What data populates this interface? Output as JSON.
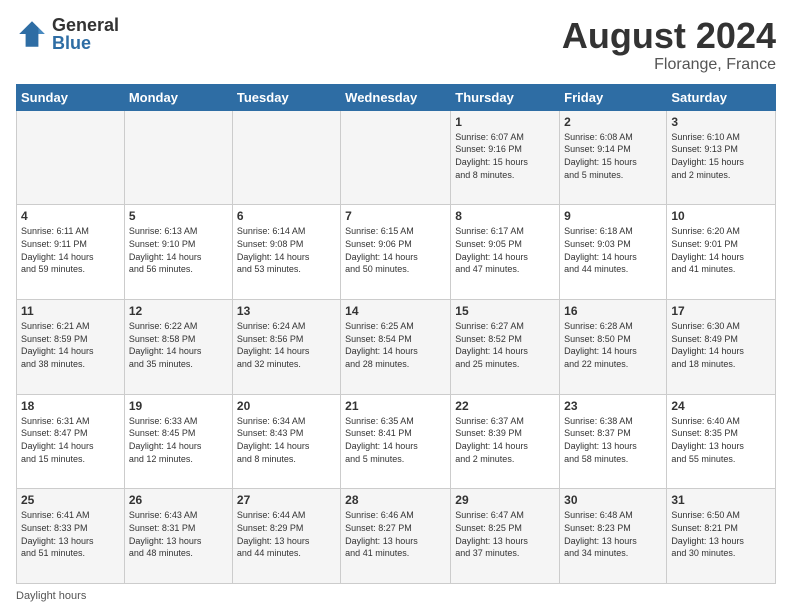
{
  "header": {
    "logo_general": "General",
    "logo_blue": "Blue",
    "month_title": "August 2024",
    "location": "Florange, France"
  },
  "footer": {
    "note": "Daylight hours"
  },
  "days_of_week": [
    "Sunday",
    "Monday",
    "Tuesday",
    "Wednesday",
    "Thursday",
    "Friday",
    "Saturday"
  ],
  "weeks": [
    [
      {
        "num": "",
        "info": ""
      },
      {
        "num": "",
        "info": ""
      },
      {
        "num": "",
        "info": ""
      },
      {
        "num": "",
        "info": ""
      },
      {
        "num": "1",
        "info": "Sunrise: 6:07 AM\nSunset: 9:16 PM\nDaylight: 15 hours\nand 8 minutes."
      },
      {
        "num": "2",
        "info": "Sunrise: 6:08 AM\nSunset: 9:14 PM\nDaylight: 15 hours\nand 5 minutes."
      },
      {
        "num": "3",
        "info": "Sunrise: 6:10 AM\nSunset: 9:13 PM\nDaylight: 15 hours\nand 2 minutes."
      }
    ],
    [
      {
        "num": "4",
        "info": "Sunrise: 6:11 AM\nSunset: 9:11 PM\nDaylight: 14 hours\nand 59 minutes."
      },
      {
        "num": "5",
        "info": "Sunrise: 6:13 AM\nSunset: 9:10 PM\nDaylight: 14 hours\nand 56 minutes."
      },
      {
        "num": "6",
        "info": "Sunrise: 6:14 AM\nSunset: 9:08 PM\nDaylight: 14 hours\nand 53 minutes."
      },
      {
        "num": "7",
        "info": "Sunrise: 6:15 AM\nSunset: 9:06 PM\nDaylight: 14 hours\nand 50 minutes."
      },
      {
        "num": "8",
        "info": "Sunrise: 6:17 AM\nSunset: 9:05 PM\nDaylight: 14 hours\nand 47 minutes."
      },
      {
        "num": "9",
        "info": "Sunrise: 6:18 AM\nSunset: 9:03 PM\nDaylight: 14 hours\nand 44 minutes."
      },
      {
        "num": "10",
        "info": "Sunrise: 6:20 AM\nSunset: 9:01 PM\nDaylight: 14 hours\nand 41 minutes."
      }
    ],
    [
      {
        "num": "11",
        "info": "Sunrise: 6:21 AM\nSunset: 8:59 PM\nDaylight: 14 hours\nand 38 minutes."
      },
      {
        "num": "12",
        "info": "Sunrise: 6:22 AM\nSunset: 8:58 PM\nDaylight: 14 hours\nand 35 minutes."
      },
      {
        "num": "13",
        "info": "Sunrise: 6:24 AM\nSunset: 8:56 PM\nDaylight: 14 hours\nand 32 minutes."
      },
      {
        "num": "14",
        "info": "Sunrise: 6:25 AM\nSunset: 8:54 PM\nDaylight: 14 hours\nand 28 minutes."
      },
      {
        "num": "15",
        "info": "Sunrise: 6:27 AM\nSunset: 8:52 PM\nDaylight: 14 hours\nand 25 minutes."
      },
      {
        "num": "16",
        "info": "Sunrise: 6:28 AM\nSunset: 8:50 PM\nDaylight: 14 hours\nand 22 minutes."
      },
      {
        "num": "17",
        "info": "Sunrise: 6:30 AM\nSunset: 8:49 PM\nDaylight: 14 hours\nand 18 minutes."
      }
    ],
    [
      {
        "num": "18",
        "info": "Sunrise: 6:31 AM\nSunset: 8:47 PM\nDaylight: 14 hours\nand 15 minutes."
      },
      {
        "num": "19",
        "info": "Sunrise: 6:33 AM\nSunset: 8:45 PM\nDaylight: 14 hours\nand 12 minutes."
      },
      {
        "num": "20",
        "info": "Sunrise: 6:34 AM\nSunset: 8:43 PM\nDaylight: 14 hours\nand 8 minutes."
      },
      {
        "num": "21",
        "info": "Sunrise: 6:35 AM\nSunset: 8:41 PM\nDaylight: 14 hours\nand 5 minutes."
      },
      {
        "num": "22",
        "info": "Sunrise: 6:37 AM\nSunset: 8:39 PM\nDaylight: 14 hours\nand 2 minutes."
      },
      {
        "num": "23",
        "info": "Sunrise: 6:38 AM\nSunset: 8:37 PM\nDaylight: 13 hours\nand 58 minutes."
      },
      {
        "num": "24",
        "info": "Sunrise: 6:40 AM\nSunset: 8:35 PM\nDaylight: 13 hours\nand 55 minutes."
      }
    ],
    [
      {
        "num": "25",
        "info": "Sunrise: 6:41 AM\nSunset: 8:33 PM\nDaylight: 13 hours\nand 51 minutes."
      },
      {
        "num": "26",
        "info": "Sunrise: 6:43 AM\nSunset: 8:31 PM\nDaylight: 13 hours\nand 48 minutes."
      },
      {
        "num": "27",
        "info": "Sunrise: 6:44 AM\nSunset: 8:29 PM\nDaylight: 13 hours\nand 44 minutes."
      },
      {
        "num": "28",
        "info": "Sunrise: 6:46 AM\nSunset: 8:27 PM\nDaylight: 13 hours\nand 41 minutes."
      },
      {
        "num": "29",
        "info": "Sunrise: 6:47 AM\nSunset: 8:25 PM\nDaylight: 13 hours\nand 37 minutes."
      },
      {
        "num": "30",
        "info": "Sunrise: 6:48 AM\nSunset: 8:23 PM\nDaylight: 13 hours\nand 34 minutes."
      },
      {
        "num": "31",
        "info": "Sunrise: 6:50 AM\nSunset: 8:21 PM\nDaylight: 13 hours\nand 30 minutes."
      }
    ]
  ]
}
